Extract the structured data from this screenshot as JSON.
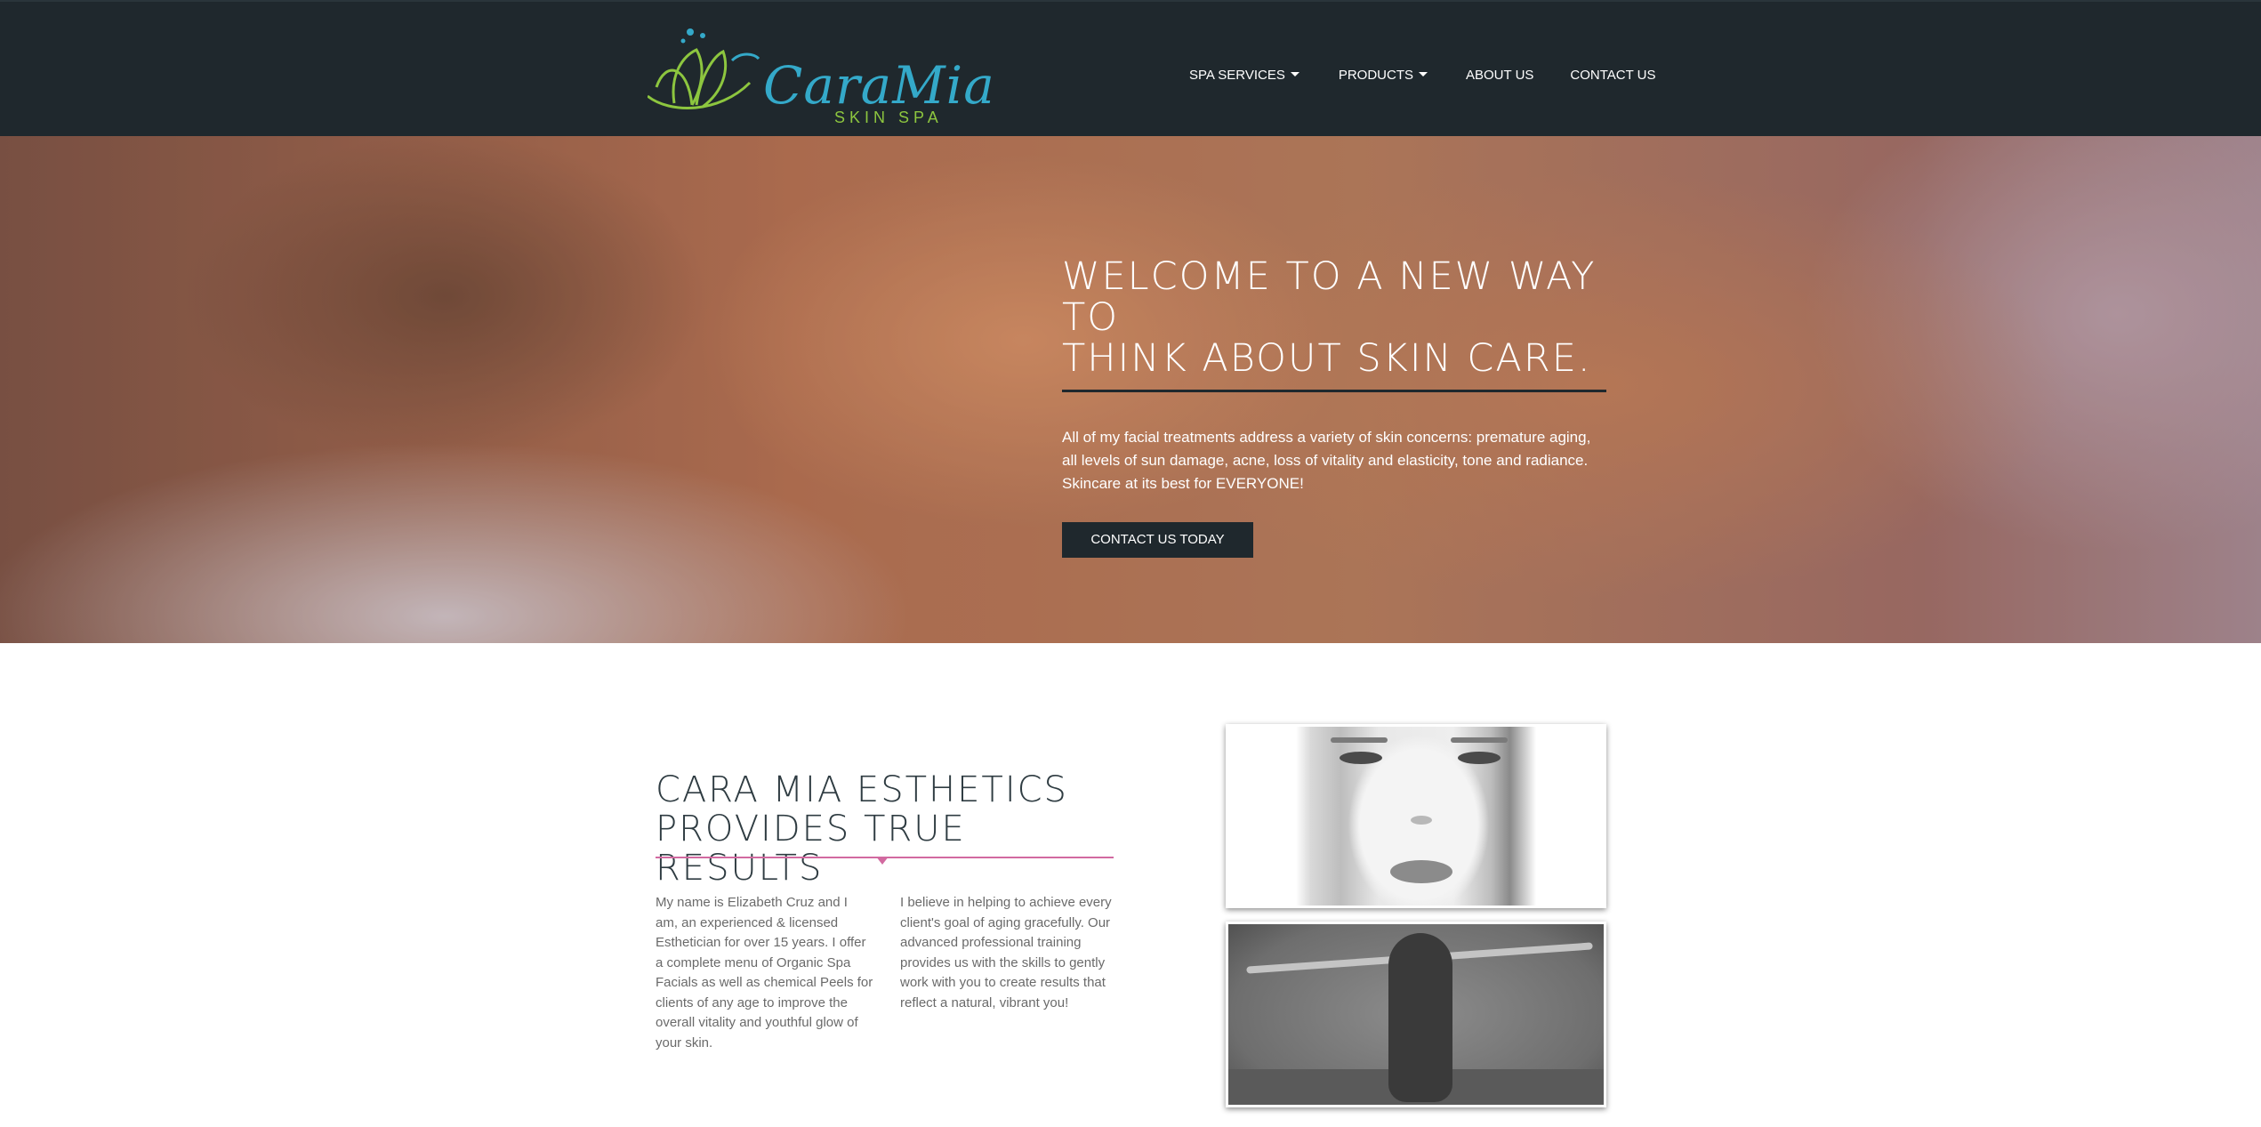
{
  "brand": {
    "logo_script": "CaraMia",
    "logo_sub": "SKIN SPA",
    "colors": {
      "logo_blue": "#34a9c9",
      "logo_green": "#8dc63f",
      "header_bg": "#1f282d",
      "accent_pink": "#d26aa0"
    }
  },
  "nav": {
    "items": [
      {
        "label": "SPA SERVICES",
        "dropdown": true
      },
      {
        "label": "PRODUCTS",
        "dropdown": true
      },
      {
        "label": "ABOUT US",
        "dropdown": false
      },
      {
        "label": "CONTACT US",
        "dropdown": false
      }
    ]
  },
  "hero": {
    "title_line1": "WELCOME TO A NEW WAY TO",
    "title_line2": "THINK ABOUT SKIN CARE.",
    "text": "All of my facial treatments address a variety of skin concerns: premature aging, all levels of sun damage, acne, loss of vitality and elasticity, tone and radiance. Skincare at its best for EVERYONE!",
    "cta_label": "CONTACT US TODAY"
  },
  "about": {
    "title_line1": "CARA MIA ESTHETICS",
    "title_line2": "PROVIDES TRUE RESULTS",
    "col1": "My name is Elizabeth Cruz and I am, an experienced & licensed Esthetician for over 15 years. I offer a complete menu of Organic Spa Facials as well as chemical Peels for clients of any age to improve the overall vitality and youthful glow of your skin.",
    "col2": "I believe in helping to achieve every client's goal of aging gracefully. Our advanced professional training provides us with the skills to gently work with you to create results that reflect a natural, vibrant you!"
  }
}
